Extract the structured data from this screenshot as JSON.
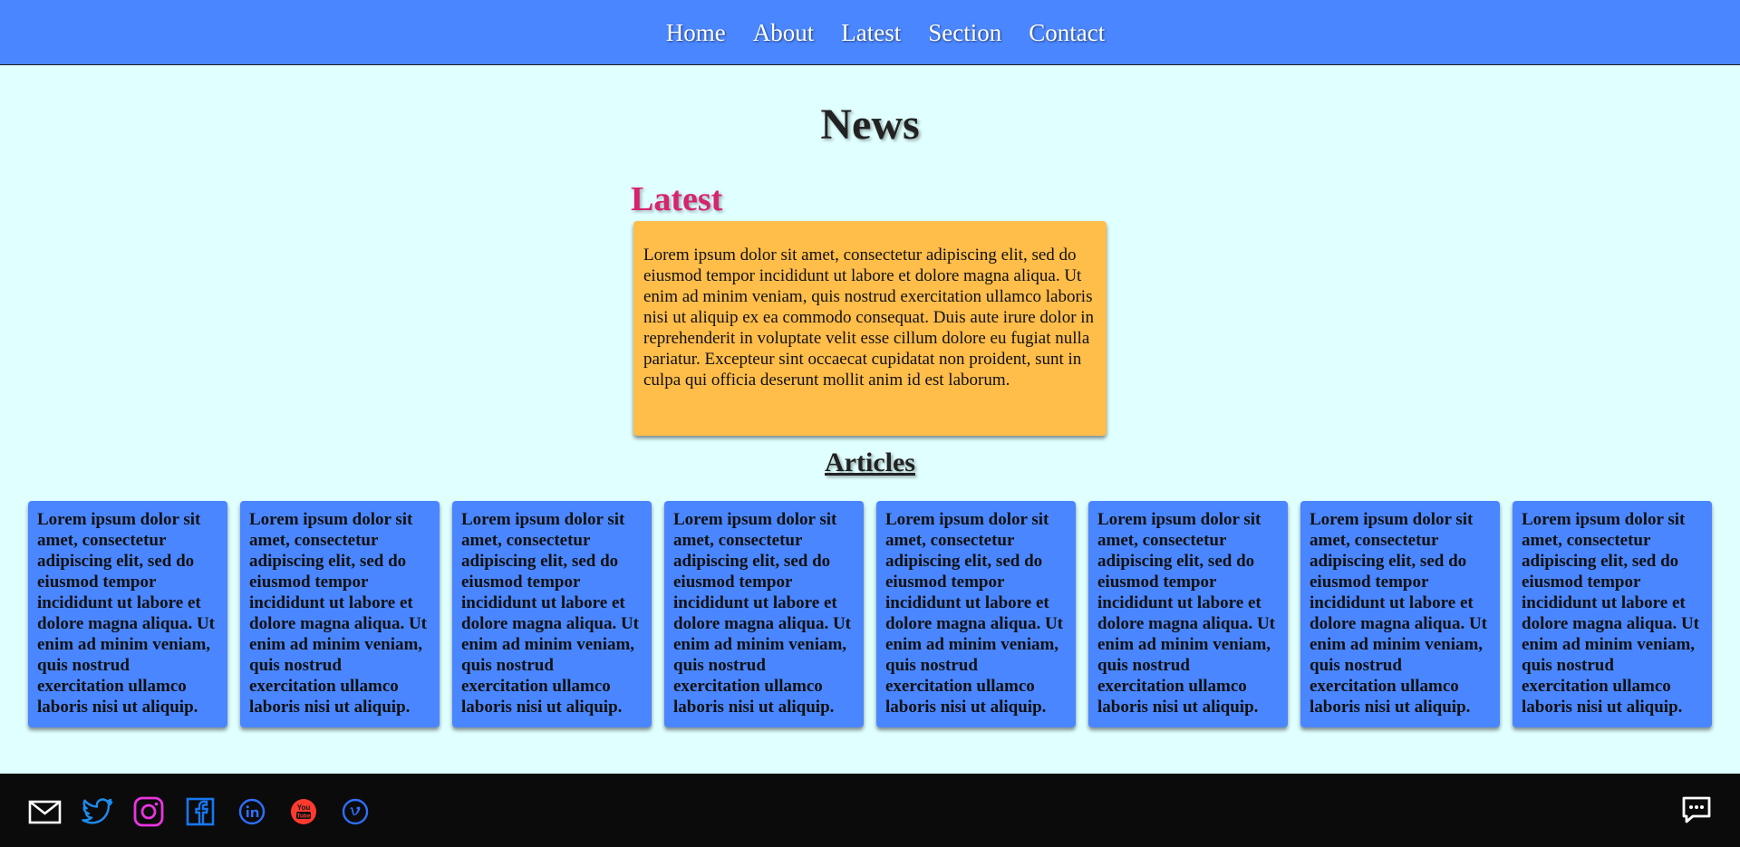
{
  "nav": {
    "items": [
      {
        "label": "Home"
      },
      {
        "label": "About"
      },
      {
        "label": "Latest"
      },
      {
        "label": "Section"
      },
      {
        "label": "Contact"
      }
    ]
  },
  "page": {
    "title": "News",
    "latest_heading": "Latest",
    "latest_text": "Lorem ipsum dolor sit amet, consectetur adipiscing elit, sed do eiusmod tempor incididunt ut labore et dolore magna aliqua. Ut enim ad minim veniam, quis nostrud exercitation ullamco laboris nisi ut aliquip ex ea commodo consequat. Duis aute irure dolor in reprehenderit in voluptate velit esse cillum dolore eu fugiat nulla pariatur. Excepteur sint occaecat cupidatat non proident, sunt in culpa qui officia deserunt mollit anim id est laborum.",
    "articles_heading": "Articles"
  },
  "articles": [
    {
      "text": "Lorem ipsum dolor sit amet, consectetur adipiscing elit, sed do eiusmod tempor incididunt ut labore et dolore magna aliqua. Ut enim ad minim veniam, quis nostrud exercitation ullamco laboris nisi ut aliquip."
    },
    {
      "text": "Lorem ipsum dolor sit amet, consectetur adipiscing elit, sed do eiusmod tempor incididunt ut labore et dolore magna aliqua. Ut enim ad minim veniam, quis nostrud exercitation ullamco laboris nisi ut aliquip."
    },
    {
      "text": "Lorem ipsum dolor sit amet, consectetur adipiscing elit, sed do eiusmod tempor incididunt ut labore et dolore magna aliqua. Ut enim ad minim veniam, quis nostrud exercitation ullamco laboris nisi ut aliquip."
    },
    {
      "text": "Lorem ipsum dolor sit amet, consectetur adipiscing elit, sed do eiusmod tempor incididunt ut labore et dolore magna aliqua. Ut enim ad minim veniam, quis nostrud exercitation ullamco laboris nisi ut aliquip."
    },
    {
      "text": "Lorem ipsum dolor sit amet, consectetur adipiscing elit, sed do eiusmod tempor incididunt ut labore et dolore magna aliqua. Ut enim ad minim veniam, quis nostrud exercitation ullamco laboris nisi ut aliquip."
    },
    {
      "text": "Lorem ipsum dolor sit amet, consectetur adipiscing elit, sed do eiusmod tempor incididunt ut labore et dolore magna aliqua. Ut enim ad minim veniam, quis nostrud exercitation ullamco laboris nisi ut aliquip."
    },
    {
      "text": "Lorem ipsum dolor sit amet, consectetur adipiscing elit, sed do eiusmod tempor incididunt ut labore et dolore magna aliqua. Ut enim ad minim veniam, quis nostrud exercitation ullamco laboris nisi ut aliquip."
    },
    {
      "text": "Lorem ipsum dolor sit amet, consectetur adipiscing elit, sed do eiusmod tempor incididunt ut labore et dolore magna aliqua. Ut enim ad minim veniam, quis nostrud exercitation ullamco laboris nisi ut aliquip."
    }
  ],
  "footer": {
    "social_icons": [
      "mail-icon",
      "twitter-icon",
      "instagram-icon",
      "facebook-icon",
      "linkedin-icon",
      "youtube-icon",
      "vimeo-icon"
    ],
    "youtube_logo_text": "You Tube",
    "chat_icon": "chat-icon"
  },
  "colors": {
    "nav_bg": "#4a86ff",
    "page_bg": "#e0ffff",
    "latest_heading": "#d6246e",
    "latest_box": "#ffbd4a",
    "article_card": "#4a86ff",
    "footer_bg": "#0b0b0b",
    "twitter": "#1d8cf0",
    "instagram": "#e935e0",
    "facebook": "#1877f2",
    "youtube": "#ff3b30"
  }
}
